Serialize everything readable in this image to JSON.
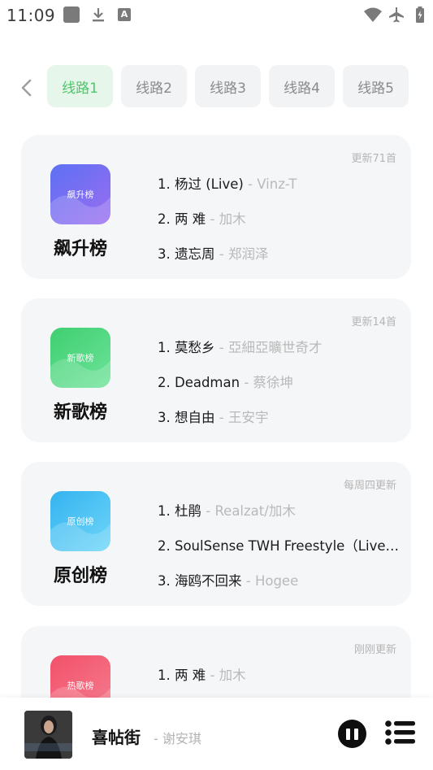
{
  "status_bar": {
    "time": "11:09",
    "icons": [
      "app-square-icon",
      "download-icon",
      "a-app-icon",
      "wifi-icon",
      "airplane-icon",
      "battery-charging-icon"
    ],
    "icon_color": "#7a7a7a"
  },
  "tabs": [
    {
      "label": "线路1",
      "active": true
    },
    {
      "label": "线路2",
      "active": false
    },
    {
      "label": "线路3",
      "active": false
    },
    {
      "label": "线路4",
      "active": false
    },
    {
      "label": "线路5",
      "active": false
    }
  ],
  "colors": {
    "accent_green": "#4cc76a",
    "tab_active_bg": "#e7f6ea",
    "card_bg": "#f5f6f8",
    "muted_text": "#b9b9b9"
  },
  "charts": [
    {
      "name": "飙升榜",
      "cover_text": "飙升榜",
      "update": "更新71首",
      "cover_color": "purple",
      "songs": [
        {
          "index": "1. 杨过 (Live)",
          "artist": " - Vinz-T"
        },
        {
          "index": "2. 两 难",
          "artist": " - 加木"
        },
        {
          "index": "3. 遗忘周",
          "artist": " - 郑润泽"
        }
      ]
    },
    {
      "name": "新歌榜",
      "cover_text": "新歌榜",
      "update": "更新14首",
      "cover_color": "green",
      "songs": [
        {
          "index": "1. 莫愁乡",
          "artist": " - 亞細亞曠世奇才"
        },
        {
          "index": "2. Deadman",
          "artist": " - 蔡徐坤"
        },
        {
          "index": "3. 想自由",
          "artist": " - 王安宇"
        }
      ]
    },
    {
      "name": "原创榜",
      "cover_text": "原创榜",
      "update": "每周四更新",
      "cover_color": "blue",
      "songs": [
        {
          "index": "1. 杜鹃",
          "artist": " - Realzat/加木"
        },
        {
          "index": "2. SoulSense TWH Freestyle（Live）...",
          "artist": ""
        },
        {
          "index": "3. 海鸥不回来",
          "artist": " - Hogee"
        }
      ]
    },
    {
      "name": "热歌榜",
      "cover_text": "热歌榜",
      "update": "刚刚更新",
      "cover_color": "red",
      "songs": [
        {
          "index": "1. 两 难",
          "artist": " - 加木"
        }
      ]
    }
  ],
  "player": {
    "title": "喜帖街",
    "artist": "- 谢安琪",
    "cover_icon": "album-cover-image",
    "pause_icon": "pause-icon",
    "playlist_icon": "playlist-icon"
  }
}
